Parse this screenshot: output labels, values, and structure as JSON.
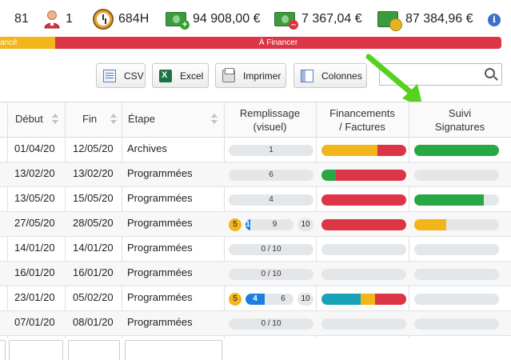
{
  "stats": {
    "products": "81",
    "users": "1",
    "hours": "684H",
    "income": "94 908,00 €",
    "expenses": "7 367,04 €",
    "total": "87 384,96 €",
    "info": "i"
  },
  "band": {
    "left_label": "ancé",
    "right_label": "À Financer",
    "left_color": "#f2b51a",
    "right_color": "#dc3545"
  },
  "toolbar": {
    "csv": "CSV",
    "excel": "Excel",
    "print": "Imprimer",
    "columns": "Colonnes",
    "search_placeholder": ""
  },
  "table": {
    "headers": {
      "debut": "Début",
      "fin": "Fin",
      "etape": "Étape",
      "remplissage_1": "Remplissage",
      "remplissage_2": "(visuel)",
      "financements_1": "Financements",
      "financements_2": "/ Factures",
      "suivi_1": "Suivi",
      "suivi_2": "Signatures"
    },
    "colors": {
      "green": "#28a745",
      "red": "#dc3545",
      "yellow": "#f2b51a",
      "teal": "#17a2b8",
      "blue": "#1d7fe0",
      "track": "#e4e7ea"
    },
    "rows": [
      {
        "debut": "01/04/20",
        "fin": "12/05/20",
        "etape": "Archives",
        "fill_label": "1",
        "fill_badge": "",
        "fill_count": "",
        "fill_total": "",
        "fill_progress": 0,
        "fin_bar": [
          {
            "c": "yellow",
            "v": 0.66
          },
          {
            "c": "red",
            "v": 0.34
          }
        ],
        "sig_bar": [
          {
            "c": "green",
            "v": 1.0
          }
        ]
      },
      {
        "debut": "13/02/20",
        "fin": "13/02/20",
        "etape": "Programmées",
        "fill_label": "6",
        "fill_badge": "",
        "fill_count": "",
        "fill_total": "",
        "fill_progress": 0,
        "fin_bar": [
          {
            "c": "green",
            "v": 0.17
          },
          {
            "c": "red",
            "v": 0.83
          }
        ],
        "sig_bar": []
      },
      {
        "debut": "13/05/20",
        "fin": "15/05/20",
        "etape": "Programmées",
        "fill_label": "4",
        "fill_badge": "",
        "fill_count": "",
        "fill_total": "",
        "fill_progress": 0,
        "fin_bar": [
          {
            "c": "red",
            "v": 1.0
          }
        ],
        "sig_bar": [
          {
            "c": "green",
            "v": 0.82
          }
        ]
      },
      {
        "debut": "27/05/20",
        "fin": "28/05/20",
        "etape": "Programmées",
        "fill_label": "9",
        "fill_badge": "5",
        "fill_count": "1",
        "fill_total": "10",
        "fill_progress": 0.05,
        "fin_bar": [
          {
            "c": "red",
            "v": 1.0
          }
        ],
        "sig_bar": [
          {
            "c": "yellow",
            "v": 0.38
          }
        ]
      },
      {
        "debut": "14/01/20",
        "fin": "14/01/20",
        "etape": "Programmées",
        "fill_label": "0 / 10",
        "fill_badge": "",
        "fill_count": "",
        "fill_total": "",
        "fill_progress": 0,
        "fin_bar": [],
        "sig_bar": []
      },
      {
        "debut": "16/01/20",
        "fin": "16/01/20",
        "etape": "Programmées",
        "fill_label": "0 / 10",
        "fill_badge": "",
        "fill_count": "",
        "fill_total": "",
        "fill_progress": 0,
        "fin_bar": [],
        "sig_bar": []
      },
      {
        "debut": "23/01/20",
        "fin": "05/02/20",
        "etape": "Programmées",
        "fill_label": "6",
        "fill_badge": "5",
        "fill_count": "4",
        "fill_total": "10",
        "fill_progress": 0.4,
        "fin_bar": [
          {
            "c": "teal",
            "v": 0.46
          },
          {
            "c": "yellow",
            "v": 0.17
          },
          {
            "c": "red",
            "v": 0.37
          }
        ],
        "sig_bar": []
      },
      {
        "debut": "07/01/20",
        "fin": "08/01/20",
        "etape": "Programmées",
        "fill_label": "0 / 10",
        "fill_badge": "",
        "fill_count": "",
        "fill_total": "",
        "fill_progress": 0,
        "fin_bar": [],
        "sig_bar": []
      }
    ]
  }
}
